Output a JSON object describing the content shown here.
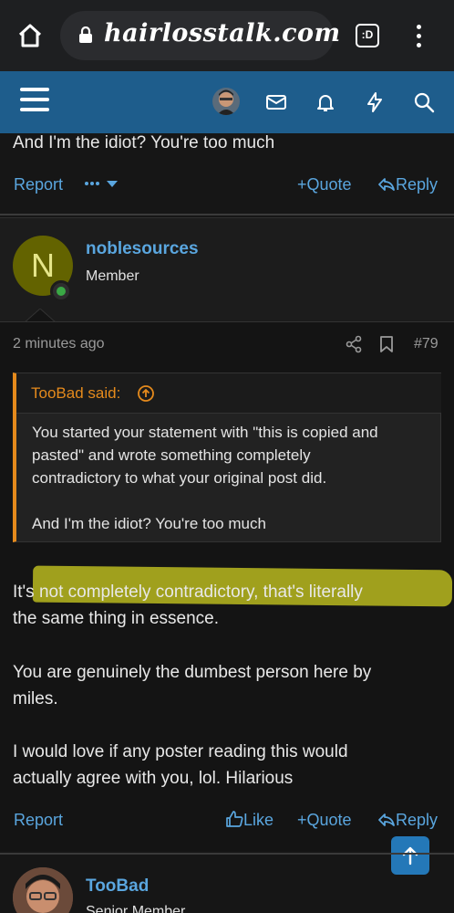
{
  "browser": {
    "url": "hairlosstalk.com",
    "tab_count": ":D"
  },
  "previous_post": {
    "last_line": "And I'm the idiot? You're too much",
    "report": "Report",
    "quote": "Quote",
    "reply": "Reply"
  },
  "post": {
    "username": "noblesources",
    "avatar_letter": "N",
    "role": "Member",
    "time": "2 minutes ago",
    "number": "#79",
    "quote": {
      "author": "TooBad said:",
      "lines": [
        "You started your statement with \"this is copied and",
        "pasted\" and wrote something completely",
        "contradictory to what your original post did.",
        "And I'm the idiot? You're too much"
      ]
    },
    "body": [
      "It's not completely contradictory, that's literally",
      "the same thing in essence.",
      "You are genuinely the dumbest person here by",
      "miles.",
      "I would love if any poster reading this would",
      "actually agree with you, lol. Hilarious"
    ],
    "actions": {
      "report": "Report",
      "like": "Like",
      "quote": "Quote",
      "reply": "Reply"
    }
  },
  "next_post": {
    "username": "TooBad",
    "role": "Senior Member"
  },
  "colors": {
    "header": "#1e5d8c",
    "link": "#5aa6df",
    "quote_accent": "#e58a1c",
    "highlight": "#b9b91e"
  },
  "icons": [
    "home-icon",
    "lock-icon",
    "tabs-icon",
    "more-vert-icon",
    "menu-icon",
    "mail-icon",
    "bell-icon",
    "bolt-icon",
    "search-icon",
    "share-icon",
    "bookmark-icon",
    "arrow-up-circle-icon",
    "thumbs-up-icon",
    "reply-icon",
    "arrow-up-icon"
  ]
}
